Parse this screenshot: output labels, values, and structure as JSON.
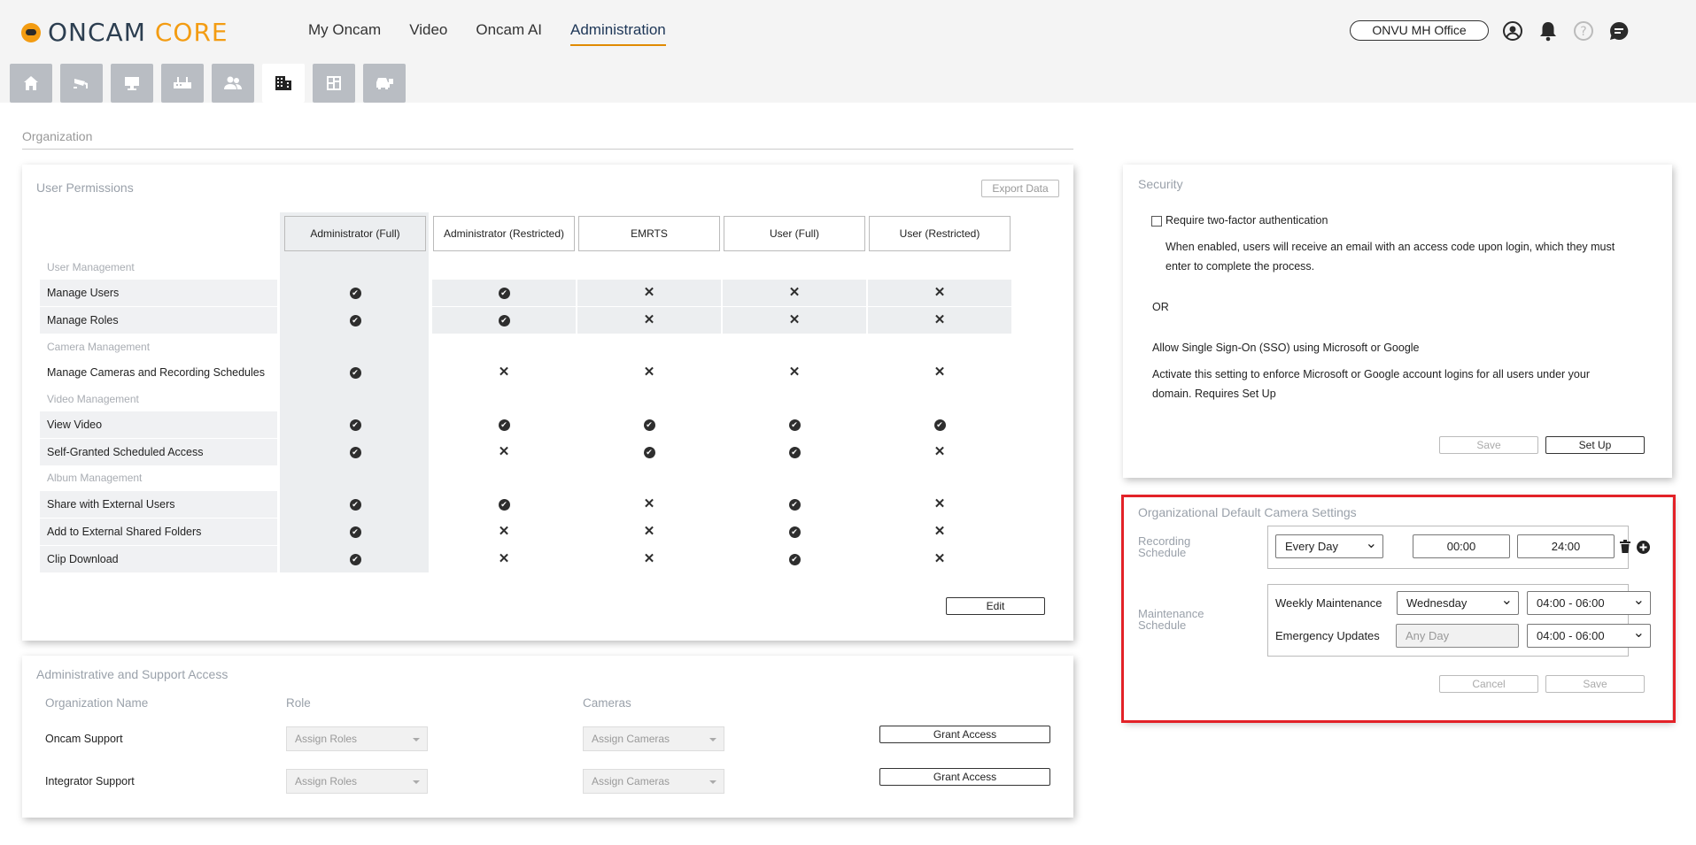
{
  "brand": {
    "part1": "ONCAM",
    "part2": "CORE"
  },
  "nav": {
    "items": [
      "My Oncam",
      "Video",
      "Oncam AI",
      "Administration"
    ],
    "active": "Administration"
  },
  "site": {
    "label": "ONVU MH Office"
  },
  "toolbar": {
    "icons": [
      "home-icon",
      "camera-icon",
      "monitor-icon",
      "recorder-icon",
      "users-icon",
      "building-icon",
      "floorplan-icon",
      "vehicle-icon"
    ],
    "active_index": 5
  },
  "organization": {
    "title": "Organization"
  },
  "permissions": {
    "title": "User Permissions",
    "export_label": "Export Data",
    "columns": [
      "Administrator (Full)",
      "Administrator (Restricted)",
      "EMRTS",
      "User (Full)",
      "User (Restricted)"
    ],
    "groups": {
      "user_management": "User Management",
      "camera_management": "Camera Management",
      "video_management": "Video Management",
      "album_management": "Album Management"
    },
    "rows": [
      {
        "label": "Manage Users",
        "values": [
          true,
          true,
          false,
          false,
          false
        ]
      },
      {
        "label": "Manage Roles",
        "values": [
          true,
          true,
          false,
          false,
          false
        ]
      },
      {
        "label": "Manage Cameras and Recording Schedules",
        "values": [
          true,
          false,
          false,
          false,
          false
        ]
      },
      {
        "label": "View Video",
        "values": [
          true,
          true,
          true,
          true,
          true
        ]
      },
      {
        "label": "Self-Granted Scheduled Access",
        "values": [
          true,
          false,
          true,
          true,
          false
        ]
      },
      {
        "label": "Share with External Users",
        "values": [
          true,
          true,
          false,
          true,
          false
        ]
      },
      {
        "label": "Add to External Shared Folders",
        "values": [
          true,
          false,
          false,
          true,
          false
        ]
      },
      {
        "label": "Clip Download",
        "values": [
          true,
          false,
          false,
          true,
          false
        ]
      }
    ],
    "edit_label": "Edit"
  },
  "access": {
    "title": "Administrative and Support Access",
    "headers": {
      "name": "Organization Name",
      "role": "Role",
      "cameras": "Cameras"
    },
    "rows": [
      {
        "name": "Oncam Support",
        "role_placeholder": "Assign Roles",
        "cameras_placeholder": "Assign Cameras",
        "button": "Grant Access"
      },
      {
        "name": "Integrator Support",
        "role_placeholder": "Assign Roles",
        "cameras_placeholder": "Assign Cameras",
        "button": "Grant Access"
      }
    ]
  },
  "security": {
    "title": "Security",
    "two_factor_label": "Require two-factor authentication",
    "two_factor_desc_line1": "When enabled, users will receive an email with an access code upon login, which they must",
    "two_factor_desc_line2": "enter to complete the process.",
    "or": "OR",
    "sso_label": "Allow Single Sign-On (SSO) using Microsoft or Google",
    "sso_desc_line1": "Activate this setting to enforce Microsoft or Google account logins for all users under your",
    "sso_desc_line2": "domain. Requires Set Up",
    "save_label": "Save",
    "setup_label": "Set Up"
  },
  "camera_settings": {
    "title": "Organizational Default Camera Settings",
    "recording_label_1": "Recording",
    "recording_label_2": "Schedule",
    "recording_days": "Every Day",
    "start_time": "00:00",
    "end_time": "24:00",
    "maintenance_label_1": "Maintenance",
    "maintenance_label_2": "Schedule",
    "weekly_label": "Weekly Maintenance",
    "weekly_day": "Wednesday",
    "weekly_window": "04:00 - 06:00",
    "emergency_label": "Emergency Updates",
    "emergency_day_placeholder": "Any Day",
    "emergency_window": "04:00 - 06:00",
    "cancel_label": "Cancel",
    "save_label": "Save",
    "highlight_color": "#e32228"
  },
  "colors": {
    "accent": "#f39c12",
    "nav_underline": "#e08a00",
    "tool_bg": "#b9bdc3"
  }
}
